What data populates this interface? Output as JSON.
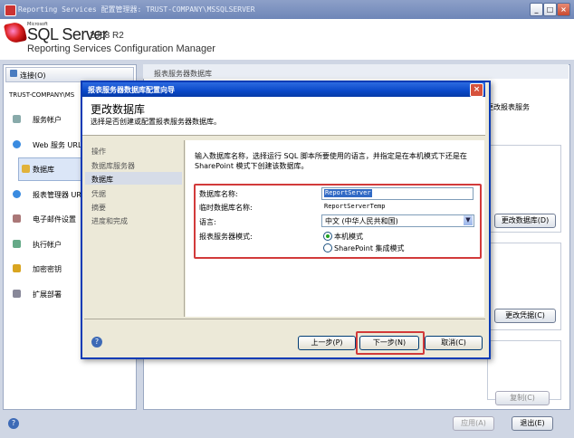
{
  "window": {
    "title": "Reporting Services 配置管理器: TRUST-COMPANY\\MSSQLSERVER"
  },
  "banner": {
    "microsoft": "Microsoft",
    "product": "SQL Server",
    "version": "2008 R2",
    "subtitle": "Reporting Services Configuration Manager"
  },
  "sidebar": {
    "connect_label": "连接(O)",
    "server": "TRUST-COMPANY\\MS",
    "items": [
      {
        "label": "服务帐户",
        "icon": "service-account-icon"
      },
      {
        "label": "Web 服务 URL",
        "icon": "globe-icon"
      },
      {
        "label": "数据库",
        "icon": "database-icon"
      },
      {
        "label": "报表管理器 URL",
        "icon": "globe-icon"
      },
      {
        "label": "电子邮件设置",
        "icon": "email-icon"
      },
      {
        "label": "执行帐户",
        "icon": "execution-account-icon"
      },
      {
        "label": "加密密钥",
        "icon": "key-icon"
      },
      {
        "label": "扩展部署",
        "icon": "scale-out-icon"
      }
    ]
  },
  "content": {
    "title": "报表服务器数据库",
    "note": "更改报表服务",
    "change_db_button": "更改数据库(D)",
    "change_cred_button": "更改凭据(C)",
    "copy_button": "复制(C)",
    "apply_button": "应用(A)",
    "exit_button": "退出(E)"
  },
  "dialog": {
    "title": "报表服务器数据库配置向导",
    "heading": "更改数据库",
    "subheading": "选择是否创建或配置报表服务器数据库。",
    "nav": [
      "操作",
      "数据库服务器",
      "数据库",
      "凭据",
      "摘要",
      "进度和完成"
    ],
    "selected_nav": "数据库",
    "intro": "输入数据库名称，选择运行 SQL 脚本所要使用的语言，并指定是在本机模式下还是在 SharePoint 模式下创建该数据库。",
    "form": {
      "db_name_label": "数据库名称:",
      "db_name_value": "ReportServer",
      "temp_db_label": "临时数据库名称:",
      "temp_db_value": "ReportServerTemp",
      "language_label": "语言:",
      "language_value": "中文 (中华人民共和国)",
      "mode_label": "报表服务器模式:",
      "mode_native": "本机模式",
      "mode_sharepoint": "SharePoint 集成模式",
      "selected_mode": "本机模式"
    },
    "buttons": {
      "prev": "上一步(P)",
      "next": "下一步(N)",
      "cancel": "取消(C)"
    }
  },
  "colors": {
    "highlight": "#d23a3a",
    "dialog_title": "#0a48c8",
    "selection": "#316ac5"
  }
}
